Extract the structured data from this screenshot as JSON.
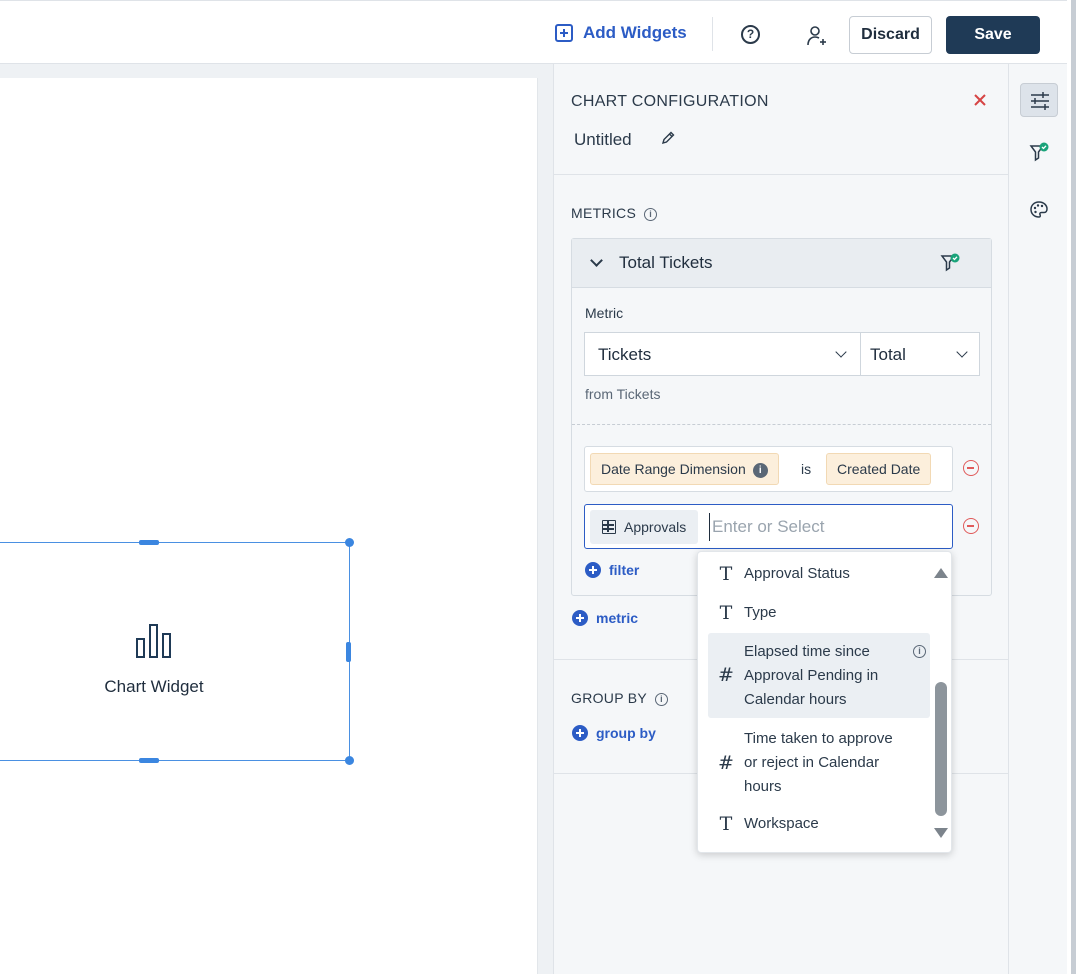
{
  "toolbar": {
    "add_widgets_label": "Add Widgets",
    "help_icon": "?",
    "discard_label": "Discard",
    "save_label": "Save"
  },
  "widget": {
    "label": "Chart Widget",
    "icon": "bar-chart-icon"
  },
  "panel": {
    "title": "CHART CONFIGURATION",
    "chart_name": "Untitled",
    "metrics_label": "METRICS",
    "metric": {
      "name": "Total Tickets",
      "field_label": "Metric",
      "metric_value": "Tickets",
      "aggregation_value": "Total",
      "from_text": "from Tickets"
    },
    "conditions": [
      {
        "dimension_chip": "Date Range Dimension",
        "operator": "is",
        "value_chip": "Created Date"
      },
      {
        "entity_chip": "Approvals",
        "input_placeholder": "Enter or Select",
        "input_value": ""
      }
    ],
    "add_filter_label": "filter",
    "add_metric_label": "metric",
    "group_by_label": "GROUP BY",
    "add_group_by_label": "group by"
  },
  "dropdown": {
    "items": [
      {
        "type": "text",
        "glyph": "T",
        "label": "Approval Status"
      },
      {
        "type": "text",
        "glyph": "T",
        "label": "Type"
      },
      {
        "type": "number",
        "glyph": "#",
        "label": "Elapsed time since Approval Pending in Calendar hours",
        "has_info": true
      },
      {
        "type": "number",
        "glyph": "#",
        "label": "Time taken to approve or reject in Calendar hours"
      },
      {
        "type": "text",
        "glyph": "T",
        "label": "Workspace"
      }
    ]
  },
  "colors": {
    "accent": "#2c5cc5",
    "save_bg": "#1f3a56",
    "widget_border": "#4a90e2",
    "remove": "#e05b5b",
    "chip_bg": "#fcefdc",
    "filter_check": "#1aa37a"
  }
}
